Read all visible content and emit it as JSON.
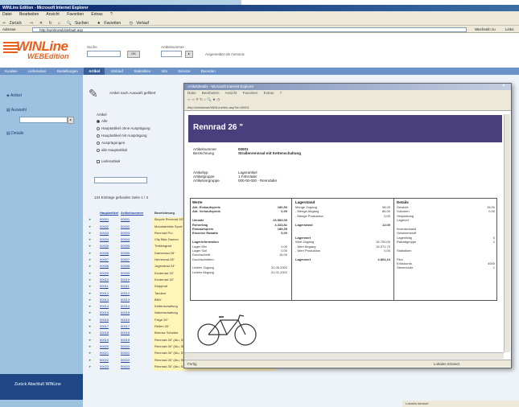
{
  "browser": {
    "title": "WINLine Edition - Microsoft Internet Explorer",
    "menu": [
      "Datei",
      "Bearbeiten",
      "Ansicht",
      "Favoriten",
      "Extras",
      "?"
    ],
    "toolbar": [
      "Zurück",
      "Suchen",
      "Favoriten",
      "Verlauf"
    ],
    "address_label": "Adresse",
    "address": "http://winlinewb/default.asp",
    "go_label": "Wechseln zu",
    "links_label": "Links"
  },
  "app": {
    "logo_main": "WINLine",
    "logo_sub": "WEBEdition",
    "search_label": "Suche",
    "artikel_label": "Artikelnummer",
    "go_btn": "OK",
    "user": "Angemeldet als mesonic"
  },
  "nav": [
    "Kunden",
    "Lieferanten",
    "Bestellungen",
    "Artikel",
    "Verkauf",
    "Statistiken",
    "Info",
    "Service",
    "Beenden"
  ],
  "nav_active": 3,
  "sidebar": {
    "items": [
      "Artikel",
      "Auswahl",
      "Details"
    ],
    "bottom": "Zurück Abschluß WINLine"
  },
  "filter": {
    "title": "Artikel nach Auswahl gefiltert",
    "group_label": "Artikel",
    "options": [
      "Alle",
      "Hauptartikel ohne Ausprägung",
      "Hauptartikel mit Ausprägung",
      "Ausprägungen",
      "alle Hauptartikel"
    ],
    "checkbox": "Lieferartikel",
    "result_text": "134 Einträge gefunden   Seite 1 / 3"
  },
  "list": {
    "headers": [
      "",
      "Hauptartikel",
      "Artikelnummer",
      "Bezeichnung"
    ],
    "rows": [
      [
        "",
        "00001",
        "00001",
        "Bicycle Rennrad 26\"",
        ""
      ],
      [
        "",
        "00002",
        "00002",
        "Mountainbike Sport",
        ""
      ],
      [
        "",
        "00003",
        "00003",
        "Rennrad Pro",
        ""
      ],
      [
        "",
        "00004",
        "00004",
        "City Bike Damen",
        ""
      ],
      [
        "",
        "00005",
        "00005",
        "Trekkingrad",
        ""
      ],
      [
        "",
        "00006",
        "00006",
        "Damenrad 28\"",
        ""
      ],
      [
        "",
        "00007",
        "00007",
        "Herrenrad 28\"",
        ""
      ],
      [
        "",
        "00008",
        "00008",
        "Jugendrad 24\"",
        ""
      ],
      [
        "",
        "00009",
        "00009",
        "Kinderrad 20\"",
        ""
      ],
      [
        "",
        "00010",
        "00010",
        "Kinderrad 16\"",
        ""
      ],
      [
        "",
        "00011",
        "00011",
        "Klapprad",
        ""
      ],
      [
        "",
        "00012",
        "00012",
        "Tandem",
        ""
      ],
      [
        "",
        "00013",
        "00013",
        "BMX",
        ""
      ],
      [
        "",
        "00014",
        "00014",
        "Kettenschaltung",
        ""
      ],
      [
        "",
        "00015",
        "00015",
        "Nabenschaltung",
        ""
      ],
      [
        "",
        "00016",
        "00016",
        "Felge 26\"",
        ""
      ],
      [
        "",
        "00017",
        "00017",
        "Reifen 26\"",
        ""
      ],
      [
        "",
        "00018",
        "00018",
        "Bremse Scheibe",
        ""
      ],
      [
        "",
        "00019",
        "00019",
        "Rennrad 26\" (Alu, 53cm)",
        ""
      ],
      [
        "",
        "00020",
        "00020",
        "Rennrad 26\" (Alu, 55cm)",
        ""
      ],
      [
        "",
        "00021",
        "00021",
        "Rennrad 26\" (Alu, 57cm)",
        ""
      ],
      [
        "",
        "00022",
        "00022",
        "Rennrad 26\" (Alu, 59cm)",
        ""
      ],
      [
        "",
        "00023",
        "00023",
        "Rennrad 26\" (Alu, 61cm)",
        ""
      ]
    ]
  },
  "popup": {
    "title": "Artikeldetails - Microsoft Internet Explorer",
    "menu": [
      "Datei",
      "Bearbeiten",
      "Ansicht",
      "Favoriten",
      "Extras",
      "?"
    ],
    "address": "http://winlinewb/WINLine/fen.asp?id=00001",
    "heading": "Rennrad 26 \"",
    "info": [
      {
        "k": "Artikelnummer",
        "v": "00001"
      },
      {
        "k": "Bezeichnung",
        "v": "Straßenrennrad mit Kettenschaltung"
      }
    ],
    "info2": [
      {
        "k": "Artikeltyp",
        "v": "Lagerartikel"
      },
      {
        "k": "Artikelgruppe",
        "v": "1    Fahrräder"
      },
      {
        "k": "Artikelvorgruppe",
        "v": "000-00-000 - Rennräder"
      }
    ],
    "preise": {
      "title": "Werte",
      "rows": [
        [
          "Akt. Einkaufspreis",
          "180,50",
          true
        ],
        [
          "Akt. Verkaufspreis",
          "0,00",
          true
        ],
        [
          "",
          "",
          false
        ],
        [
          "Umsatz",
          "23.583,00",
          true
        ],
        [
          "Rohertrag",
          "4.333,81",
          true
        ],
        [
          "Einkaufspreis",
          "189,35",
          true
        ],
        [
          "Einzelne Rabatte",
          "0,00",
          true
        ],
        [
          "",
          "",
          false
        ],
        [
          "Lagerinformation",
          "",
          true
        ],
        [
          "Lager Min",
          "0,00",
          false
        ],
        [
          "Lager Soll",
          "0,00",
          false
        ],
        [
          "Durchschnitt",
          "16,00",
          false
        ],
        [
          "Durchschnitten",
          "",
          false
        ],
        [
          "",
          "",
          false
        ],
        [
          "Letzter Zugang",
          "31.05.2002",
          false
        ],
        [
          "Letzter Abgang",
          "01.01.2002",
          false
        ]
      ]
    },
    "lager": {
      "title": "Lagerstand",
      "rows": [
        [
          "Menge Zugang",
          "98,00",
          false
        ],
        [
          "- Menge Abgang",
          "86,00",
          false
        ],
        [
          "- Menge Produktion",
          "0,00",
          false
        ],
        [
          "",
          "",
          false
        ],
        [
          "Lagerstand",
          "12,00",
          true
        ],
        [
          "",
          "",
          false
        ],
        [
          "",
          "",
          false
        ],
        [
          "Lagerwert",
          "",
          true
        ],
        [
          "Wert Zugang",
          "16.700,00",
          false
        ],
        [
          "- Wert Abgang",
          "15.071,70",
          false
        ],
        [
          "- Wert Produktion",
          "0,00",
          false
        ],
        [
          "",
          "",
          false
        ],
        [
          "Lagerwert",
          "4.804,24",
          true
        ]
      ]
    },
    "details": {
      "title": "Details",
      "rows": [
        [
          "Gewicht",
          "15,00"
        ],
        [
          "Volumen",
          "0,00"
        ],
        [
          "Verpackung",
          ""
        ],
        [
          "Lagerort",
          ""
        ],
        [
          "",
          ""
        ],
        [
          "Inventurstand",
          ""
        ],
        [
          "Gefahrenstoff",
          ""
        ],
        [
          "Lagerfähig",
          "0"
        ],
        [
          "Rabattgruppe",
          "1"
        ],
        [
          "",
          ""
        ],
        [
          "Statistiken",
          ""
        ],
        [
          "",
          ""
        ],
        [
          "Fibu",
          ""
        ],
        [
          "Erlöskonto",
          "4000"
        ],
        [
          "Steuercode",
          "1"
        ]
      ]
    },
    "status_left": "Fertig",
    "status_right": "Lokales Intranet"
  },
  "taskbar": "Lokales Intranet"
}
